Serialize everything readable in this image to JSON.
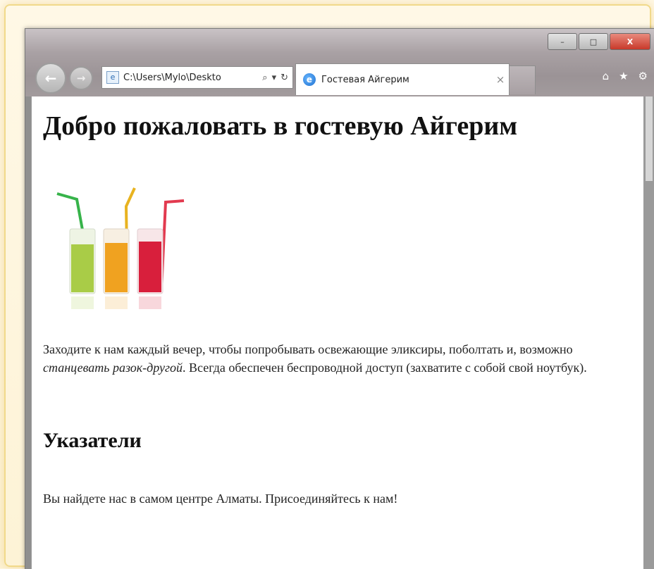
{
  "window": {
    "controls": {
      "minimize": "–",
      "maximize": "□",
      "close": "X"
    }
  },
  "toolbar": {
    "back_icon": "back-arrow-icon",
    "forward_icon": "forward-arrow-icon",
    "address": "C:\\Users\\Mylo\\Deskto",
    "search_glyph": "⌕",
    "dropdown_glyph": "▾",
    "refresh_glyph": "↻"
  },
  "tab": {
    "title": "Гостевая Айгерим",
    "close": "×"
  },
  "right_tools": {
    "home": "⌂",
    "favorites": "★",
    "settings": "⚙"
  },
  "page": {
    "heading": "Добро пожаловать в гостевую Айгерим",
    "image_name": "drinks-image",
    "paragraph": {
      "part1": "Заходите к нам каждый вечер, чтобы попробывать освежающие эликсиры, поболтать и, возможно ",
      "emphasis": "станцевать разок-другой",
      "part2": ". Всегда обеспечен беспроводной доступ (захватите с собой свой ноутбук)."
    },
    "subheading": "Указатели",
    "paragraph2": "Вы найдете нас в самом центре Алматы. Присоединяйтесь к нам!"
  },
  "colors": {
    "drink1": "#a9cc47",
    "drink2": "#f0a220",
    "drink3": "#d81f3c",
    "straw1": "#37b34a",
    "straw2": "#e8b320",
    "straw3": "#e23a4f"
  }
}
